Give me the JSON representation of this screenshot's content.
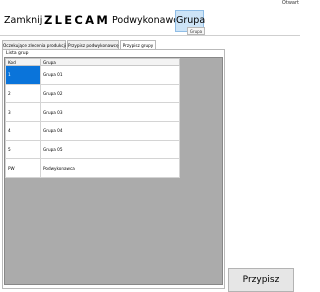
{
  "window": {
    "title_right": "Otwart"
  },
  "menu": {
    "close_label": "Zamknij",
    "brand": "ZLECAM",
    "sub_label": "Podwykonawca",
    "group_label": "Grupa",
    "group_tooltip": "Grupa"
  },
  "tabs": [
    {
      "label": "Oczekujące zlecenia produkcji"
    },
    {
      "label": "Przypisz podwykonawcę"
    },
    {
      "label": "Przypisz grupy"
    }
  ],
  "group_list": {
    "label": "Lista grup",
    "columns": [
      "Kod",
      "Grupa"
    ],
    "rows": [
      {
        "code": "1",
        "name": "Grupa 01"
      },
      {
        "code": "2",
        "name": "Grupa 02"
      },
      {
        "code": "3",
        "name": "Grupa 03"
      },
      {
        "code": "4",
        "name": "Grupa 04"
      },
      {
        "code": "5",
        "name": "Grupa 05"
      },
      {
        "code": "PW",
        "name": "Podwykonawca"
      }
    ]
  },
  "assign_button": {
    "label": "Przypisz"
  },
  "colors": {
    "selection": "#0a74da",
    "active_menu": "#cde4f7",
    "list_background": "#ababab"
  }
}
